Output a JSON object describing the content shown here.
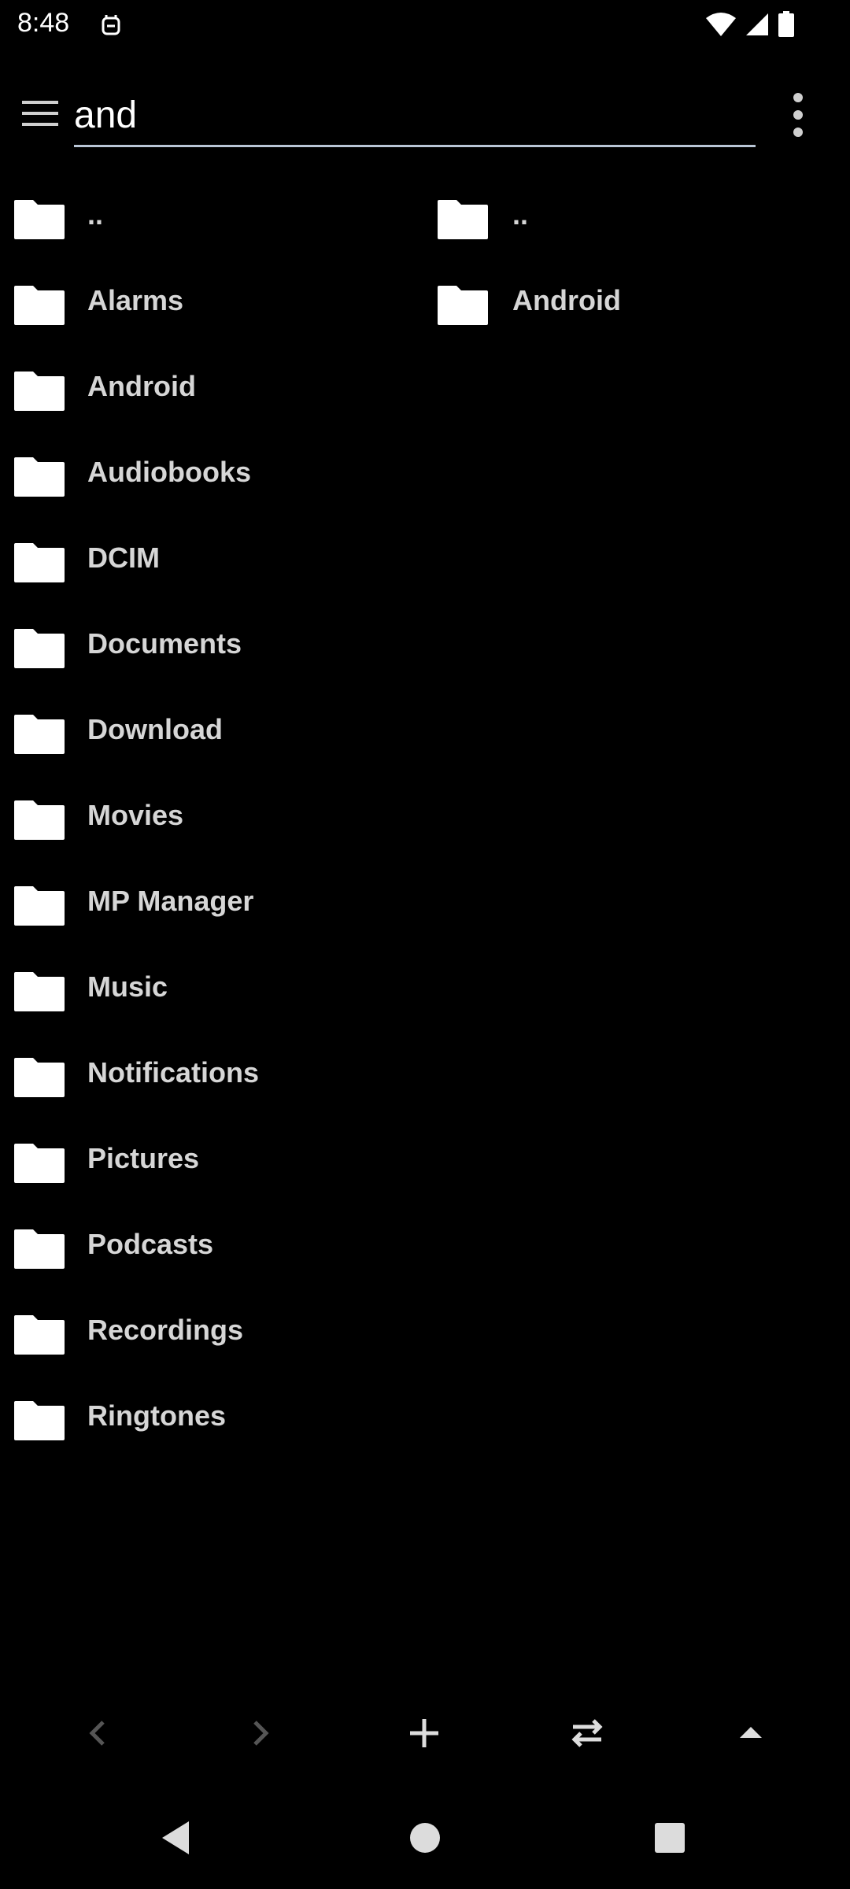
{
  "status_bar": {
    "time": "8:48"
  },
  "search": {
    "value": "and"
  },
  "left_pane": {
    "items": [
      {
        "label": ".."
      },
      {
        "label": "Alarms"
      },
      {
        "label": "Android"
      },
      {
        "label": "Audiobooks"
      },
      {
        "label": "DCIM"
      },
      {
        "label": "Documents"
      },
      {
        "label": "Download"
      },
      {
        "label": "Movies"
      },
      {
        "label": "MP Manager"
      },
      {
        "label": "Music"
      },
      {
        "label": "Notifications"
      },
      {
        "label": "Pictures"
      },
      {
        "label": "Podcasts"
      },
      {
        "label": "Recordings"
      },
      {
        "label": "Ringtones"
      }
    ]
  },
  "right_pane": {
    "items": [
      {
        "label": ".."
      },
      {
        "label": "Android"
      }
    ]
  },
  "icons": {
    "menu": "hamburger-menu-icon",
    "overflow": "more-vert-icon",
    "folder": "folder-icon",
    "back": "chevron-left-icon",
    "forward": "chevron-right-icon",
    "add": "plus-icon",
    "swap": "swap-horiz-icon",
    "up": "caret-up-icon"
  },
  "colors": {
    "background": "#000000",
    "label": "#d6d6d6",
    "underline": "#b9c6d6",
    "disabled": "#555555"
  }
}
